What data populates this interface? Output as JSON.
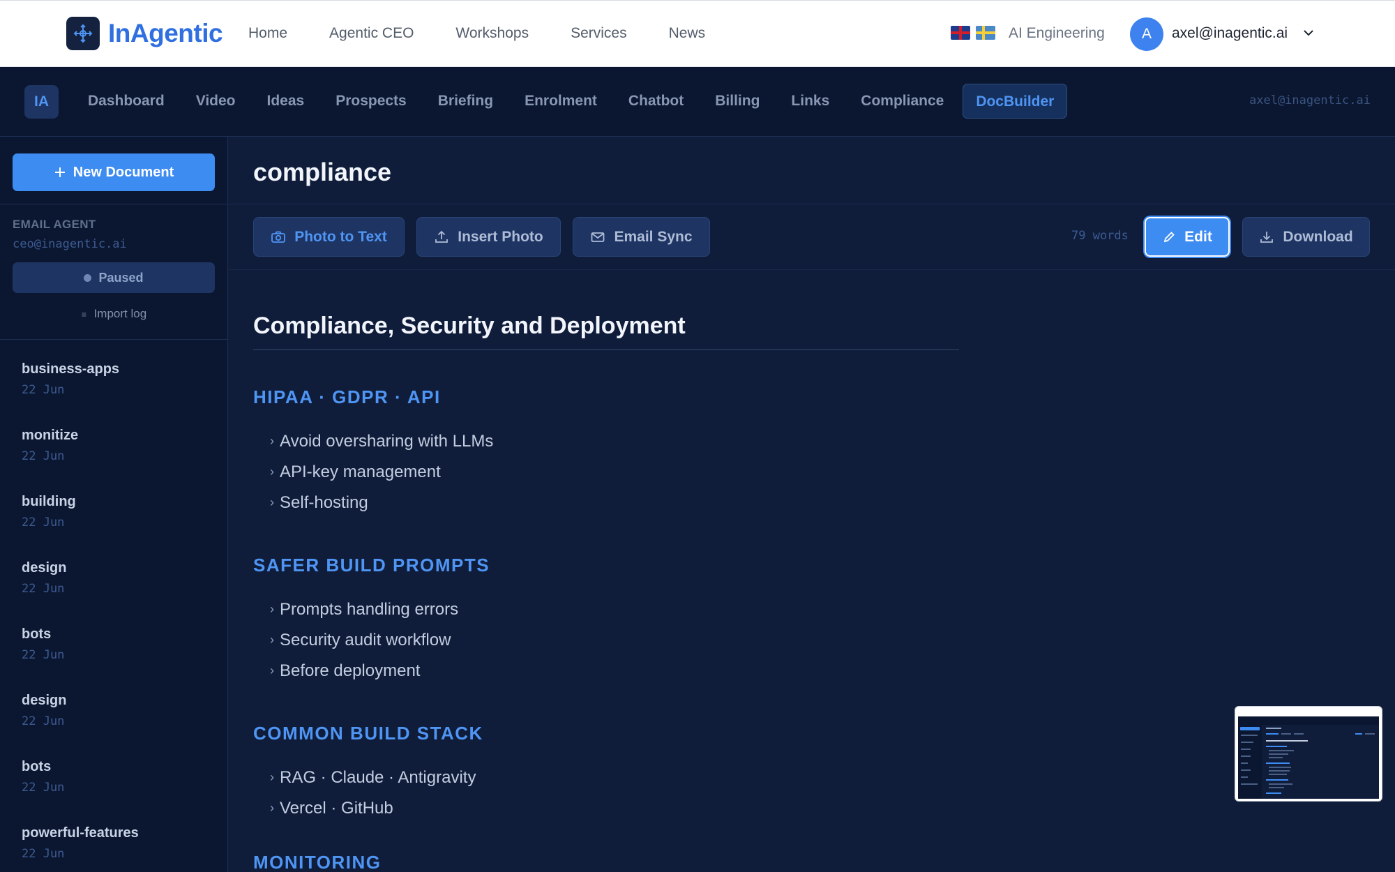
{
  "site": {
    "brand": "InAgentic",
    "nav": [
      "Home",
      "Agentic CEO",
      "Workshops",
      "Services",
      "News"
    ],
    "flags": [
      "uk-flag-icon",
      "sweden-flag-icon"
    ],
    "ai_engineering": "AI Engineering",
    "avatar_initial": "A",
    "user_email": "axel@inagentic.ai"
  },
  "app": {
    "badge": "IA",
    "tabs": [
      "Dashboard",
      "Video",
      "Ideas",
      "Prospects",
      "Briefing",
      "Enrolment",
      "Chatbot",
      "Billing",
      "Links",
      "Compliance",
      "DocBuilder"
    ],
    "active_tab": "DocBuilder",
    "user_email": "axel@inagentic.ai"
  },
  "sidebar": {
    "new_document": "New Document",
    "agent_label": "EMAIL AGENT",
    "agent_email": "ceo@inagentic.ai",
    "agent_status": "Paused",
    "import_log": "Import log",
    "documents": [
      {
        "name": "business-apps",
        "date": "22 Jun"
      },
      {
        "name": "monitize",
        "date": "22 Jun"
      },
      {
        "name": "building",
        "date": "22 Jun"
      },
      {
        "name": "design",
        "date": "22 Jun"
      },
      {
        "name": "bots",
        "date": "22 Jun"
      },
      {
        "name": "design",
        "date": "22 Jun"
      },
      {
        "name": "bots",
        "date": "22 Jun"
      },
      {
        "name": "powerful-features",
        "date": "22 Jun"
      }
    ]
  },
  "main": {
    "title": "compliance",
    "toolbar": {
      "photo_to_text": "Photo to Text",
      "insert_photo": "Insert Photo",
      "email_sync": "Email Sync",
      "word_count": "79 words",
      "edit": "Edit",
      "download": "Download"
    },
    "doc": {
      "heading": "Compliance, Security and Deployment",
      "sections": [
        {
          "title": "HIPAA · GDPR · API",
          "items": [
            "Avoid oversharing with LLMs",
            "API-key management",
            "Self-hosting"
          ]
        },
        {
          "title": "SAFER BUILD PROMPTS",
          "items": [
            "Prompts handling errors",
            "Security audit workflow",
            "Before deployment"
          ]
        },
        {
          "title": "COMMON BUILD STACK",
          "items": [
            "RAG · Claude · Antigravity",
            "Vercel · GitHub"
          ]
        },
        {
          "title": "MONITORING",
          "items": []
        }
      ]
    }
  },
  "colors": {
    "accent": "#3d8cf2",
    "brand": "#2f6fe0",
    "background": "#0f1d3a",
    "sidebar": "#0b1730"
  }
}
